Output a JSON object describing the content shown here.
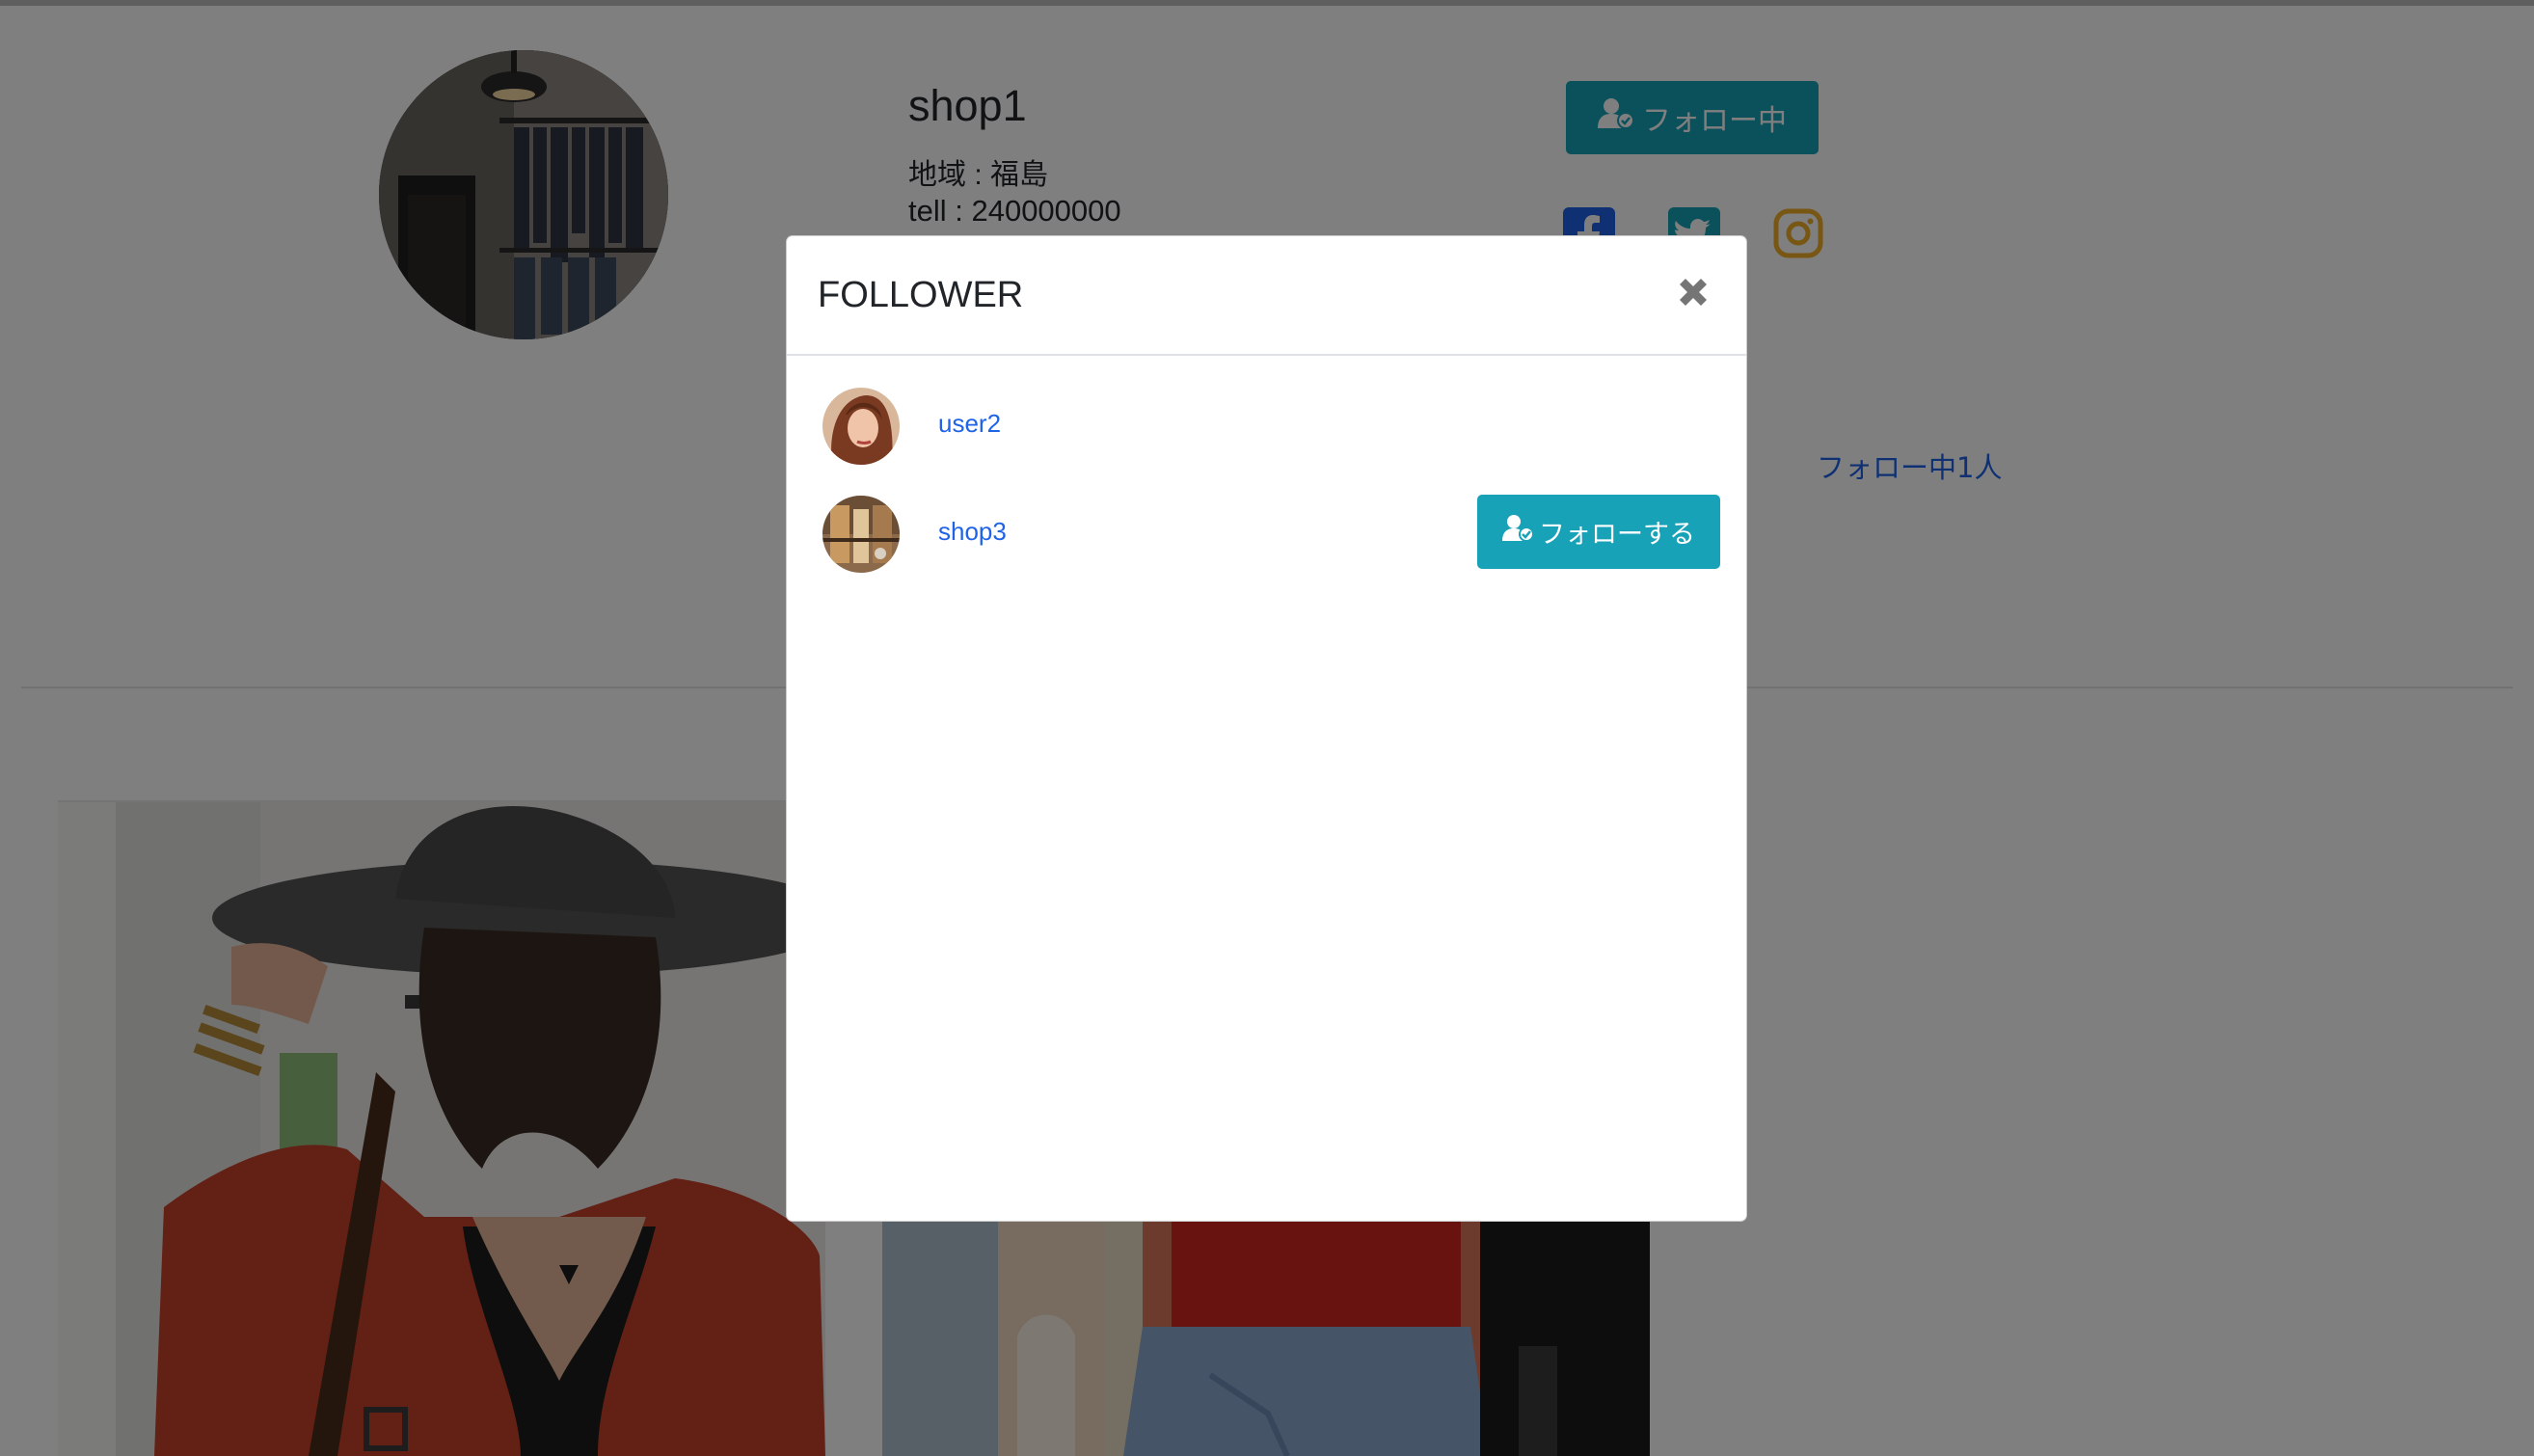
{
  "profile": {
    "name": "shop1",
    "region": "地域 : 福島",
    "tell": "tell : 240000000",
    "follow_button_label": "フォロー中",
    "following_count": "フォロー中1人"
  },
  "social": [
    {
      "icon": "facebook-icon",
      "color": "#1f63e6"
    },
    {
      "icon": "twitter-icon",
      "color": "#17a2b8"
    },
    {
      "icon": "instagram-icon",
      "color": "#f0ad28"
    }
  ],
  "modal": {
    "title": "FOLLOWER",
    "close_icon": "close-icon",
    "followers": [
      {
        "name": "user2",
        "button": null
      },
      {
        "name": "shop3",
        "button": "フォローする"
      }
    ]
  },
  "colors": {
    "accent": "#17a2b8",
    "link": "#1f63e6",
    "overlay": "rgba(0,0,0,0.5)"
  }
}
